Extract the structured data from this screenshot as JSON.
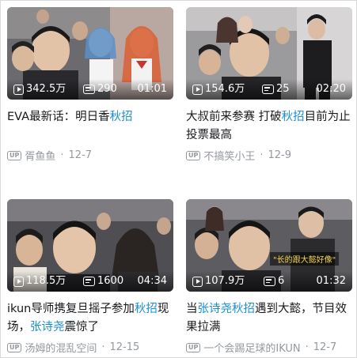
{
  "cards": [
    {
      "views": "342.5万",
      "danmaku": "290",
      "duration": "01:01",
      "title_parts": [
        {
          "text": "EVA最新话：明日香",
          "hl": false
        },
        {
          "text": "秋招",
          "hl": true
        }
      ],
      "author": "胥鱼鱼",
      "date": "12-7"
    },
    {
      "views": "154.6万",
      "danmaku": "25",
      "duration": "02:20",
      "title_parts": [
        {
          "text": "大叔前来参赛 打破",
          "hl": false
        },
        {
          "text": "秋招",
          "hl": true
        },
        {
          "text": "目前为止投票最高",
          "hl": false
        }
      ],
      "author": "不搞笑小王",
      "date": "12-9"
    },
    {
      "views": "118.5万",
      "danmaku": "1600",
      "duration": "04:34",
      "title_parts": [
        {
          "text": "ikun导师携复旦摇子参加",
          "hl": false
        },
        {
          "text": "秋招",
          "hl": true
        },
        {
          "text": "现场，",
          "hl": false
        },
        {
          "text": "张诗尧",
          "hl": true
        },
        {
          "text": "震惊了",
          "hl": false
        }
      ],
      "author": "汤姆的混乱空间",
      "date": "12-15"
    },
    {
      "views": "107.9万",
      "danmaku": "6",
      "duration": "01:32",
      "title_parts": [
        {
          "text": "当",
          "hl": false
        },
        {
          "text": "张诗尧秋招",
          "hl": true
        },
        {
          "text": "遇到大懿，节目效果拉满",
          "hl": false
        }
      ],
      "author": "一个会踢足球的IKUN",
      "date": "12-7",
      "overlay_caption": "\"长的跟大懿好像\""
    }
  ],
  "meta_separator": "·",
  "up_badge_label": "UP",
  "icons": {
    "views": "play-count-icon",
    "danmaku": "danmaku-icon",
    "author": "up-badge-icon"
  },
  "colors": {
    "highlight": "#1a8fd6",
    "title": "#18191c",
    "meta": "#9499a0"
  }
}
